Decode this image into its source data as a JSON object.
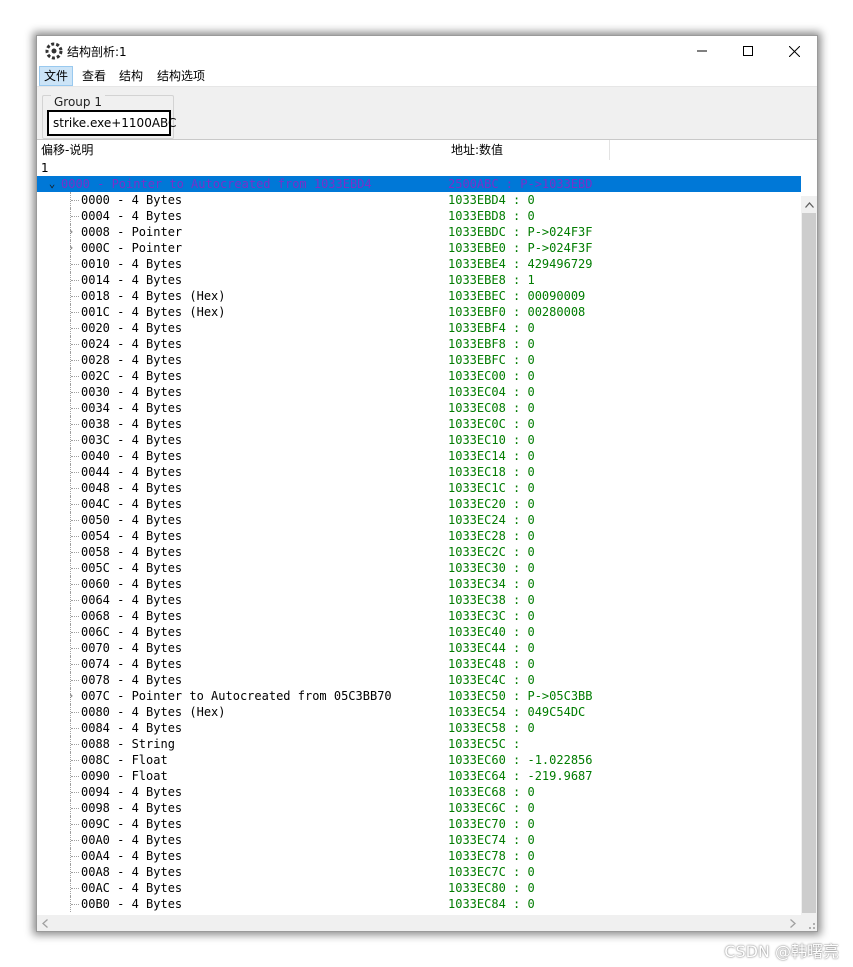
{
  "window": {
    "title": "结构剖析:1"
  },
  "menu": [
    "文件",
    "查看",
    "结构",
    "结构选项"
  ],
  "group": {
    "label": "Group 1",
    "address": "strike.exe+1100ABC"
  },
  "columns": {
    "offset_desc": "偏移-说明",
    "addr_value": "地址:数值"
  },
  "address_row": "1",
  "rows": [
    {
      "o": "0000 - Pointer to Autocreated from 1033EBD4",
      "a": "2500ABC : P->1033EBD",
      "exp": "v",
      "sel": true,
      "lvl": 0
    },
    {
      "o": "0000 - 4 Bytes",
      "a": "1033EBD4 : 0",
      "lvl": 1
    },
    {
      "o": "0004 - 4 Bytes",
      "a": "1033EBD8 : 0",
      "lvl": 1
    },
    {
      "o": "0008 - Pointer",
      "a": "1033EBDC : P->024F3F",
      "exp": ">",
      "lvl": 1
    },
    {
      "o": "000C - Pointer",
      "a": "1033EBE0 : P->024F3F",
      "exp": ">",
      "lvl": 1
    },
    {
      "o": "0010 - 4 Bytes",
      "a": "1033EBE4 : 429496729",
      "lvl": 1
    },
    {
      "o": "0014 - 4 Bytes",
      "a": "1033EBE8 : 1",
      "lvl": 1
    },
    {
      "o": "0018 - 4 Bytes (Hex)",
      "a": "1033EBEC : 00090009",
      "lvl": 1
    },
    {
      "o": "001C - 4 Bytes (Hex)",
      "a": "1033EBF0 : 00280008",
      "lvl": 1
    },
    {
      "o": "0020 - 4 Bytes",
      "a": "1033EBF4 : 0",
      "lvl": 1
    },
    {
      "o": "0024 - 4 Bytes",
      "a": "1033EBF8 : 0",
      "lvl": 1
    },
    {
      "o": "0028 - 4 Bytes",
      "a": "1033EBFC : 0",
      "lvl": 1
    },
    {
      "o": "002C - 4 Bytes",
      "a": "1033EC00 : 0",
      "lvl": 1
    },
    {
      "o": "0030 - 4 Bytes",
      "a": "1033EC04 : 0",
      "lvl": 1
    },
    {
      "o": "0034 - 4 Bytes",
      "a": "1033EC08 : 0",
      "lvl": 1
    },
    {
      "o": "0038 - 4 Bytes",
      "a": "1033EC0C : 0",
      "lvl": 1
    },
    {
      "o": "003C - 4 Bytes",
      "a": "1033EC10 : 0",
      "lvl": 1
    },
    {
      "o": "0040 - 4 Bytes",
      "a": "1033EC14 : 0",
      "lvl": 1
    },
    {
      "o": "0044 - 4 Bytes",
      "a": "1033EC18 : 0",
      "lvl": 1
    },
    {
      "o": "0048 - 4 Bytes",
      "a": "1033EC1C : 0",
      "lvl": 1
    },
    {
      "o": "004C - 4 Bytes",
      "a": "1033EC20 : 0",
      "lvl": 1
    },
    {
      "o": "0050 - 4 Bytes",
      "a": "1033EC24 : 0",
      "lvl": 1
    },
    {
      "o": "0054 - 4 Bytes",
      "a": "1033EC28 : 0",
      "lvl": 1
    },
    {
      "o": "0058 - 4 Bytes",
      "a": "1033EC2C : 0",
      "lvl": 1
    },
    {
      "o": "005C - 4 Bytes",
      "a": "1033EC30 : 0",
      "lvl": 1
    },
    {
      "o": "0060 - 4 Bytes",
      "a": "1033EC34 : 0",
      "lvl": 1
    },
    {
      "o": "0064 - 4 Bytes",
      "a": "1033EC38 : 0",
      "lvl": 1
    },
    {
      "o": "0068 - 4 Bytes",
      "a": "1033EC3C : 0",
      "lvl": 1
    },
    {
      "o": "006C - 4 Bytes",
      "a": "1033EC40 : 0",
      "lvl": 1
    },
    {
      "o": "0070 - 4 Bytes",
      "a": "1033EC44 : 0",
      "lvl": 1
    },
    {
      "o": "0074 - 4 Bytes",
      "a": "1033EC48 : 0",
      "lvl": 1
    },
    {
      "o": "0078 - 4 Bytes",
      "a": "1033EC4C : 0",
      "lvl": 1
    },
    {
      "o": "007C - Pointer to Autocreated from 05C3BB70",
      "a": "1033EC50 : P->05C3BB",
      "exp": ">",
      "lvl": 1
    },
    {
      "o": "0080 - 4 Bytes (Hex)",
      "a": "1033EC54 : 049C54DC",
      "lvl": 1
    },
    {
      "o": "0084 - 4 Bytes",
      "a": "1033EC58 : 0",
      "lvl": 1
    },
    {
      "o": "0088 - String",
      "a": "1033EC5C :",
      "lvl": 1
    },
    {
      "o": "008C - Float",
      "a": "1033EC60 : -1.022856",
      "lvl": 1
    },
    {
      "o": "0090 - Float",
      "a": "1033EC64 : -219.9687",
      "lvl": 1
    },
    {
      "o": "0094 - 4 Bytes",
      "a": "1033EC68 : 0",
      "lvl": 1
    },
    {
      "o": "0098 - 4 Bytes",
      "a": "1033EC6C : 0",
      "lvl": 1
    },
    {
      "o": "009C - 4 Bytes",
      "a": "1033EC70 : 0",
      "lvl": 1
    },
    {
      "o": "00A0 - 4 Bytes",
      "a": "1033EC74 : 0",
      "lvl": 1
    },
    {
      "o": "00A4 - 4 Bytes",
      "a": "1033EC78 : 0",
      "lvl": 1
    },
    {
      "o": "00A8 - 4 Bytes",
      "a": "1033EC7C : 0",
      "lvl": 1
    },
    {
      "o": "00AC - 4 Bytes",
      "a": "1033EC80 : 0",
      "lvl": 1
    },
    {
      "o": "00B0 - 4 Bytes",
      "a": "1033EC84 : 0",
      "lvl": 1
    }
  ],
  "watermark": "CSDN @韩曙亮",
  "colors": {
    "selection": "#0078d7",
    "value_text": "#007c00",
    "selected_text": "#7a2fc9"
  }
}
